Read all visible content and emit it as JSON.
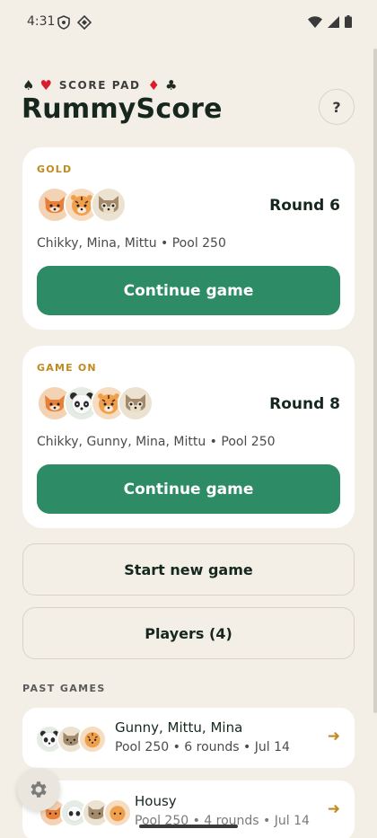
{
  "status": {
    "time": "4:31"
  },
  "header": {
    "suits_label": "SCORE PAD",
    "title": "RummyScore",
    "help_label": "?"
  },
  "games": [
    {
      "tag": "GOLD",
      "round": "Round 6",
      "players": "Chikky, Mina, Mittu • Pool 250",
      "button": "Continue game",
      "avatars": [
        "fox",
        "tiger",
        "cat"
      ]
    },
    {
      "tag": "GAME ON",
      "round": "Round 8",
      "players": "Chikky, Gunny, Mina, Mittu • Pool 250",
      "button": "Continue game",
      "avatars": [
        "fox",
        "panda",
        "tiger",
        "cat"
      ]
    }
  ],
  "actions": {
    "new_game": "Start new game",
    "players": "Players (4)"
  },
  "past": {
    "title": "PAST GAMES",
    "rows": [
      {
        "title": "Gunny, Mittu, Mina",
        "subtitle": "Pool 250 • 6 rounds • Jul 14"
      },
      {
        "title": "Housy",
        "subtitle": "Pool 250 • 4 rounds • Jul 14"
      }
    ]
  },
  "colors": {
    "background": "#f3efe7",
    "accent_green": "#2d8b66",
    "accent_gold": "#c08a1e",
    "suit_red": "#d81e2c"
  },
  "icons": {
    "help": "question-mark-icon",
    "settings": "gear-icon",
    "row_arrow": "arrow-right-icon"
  }
}
